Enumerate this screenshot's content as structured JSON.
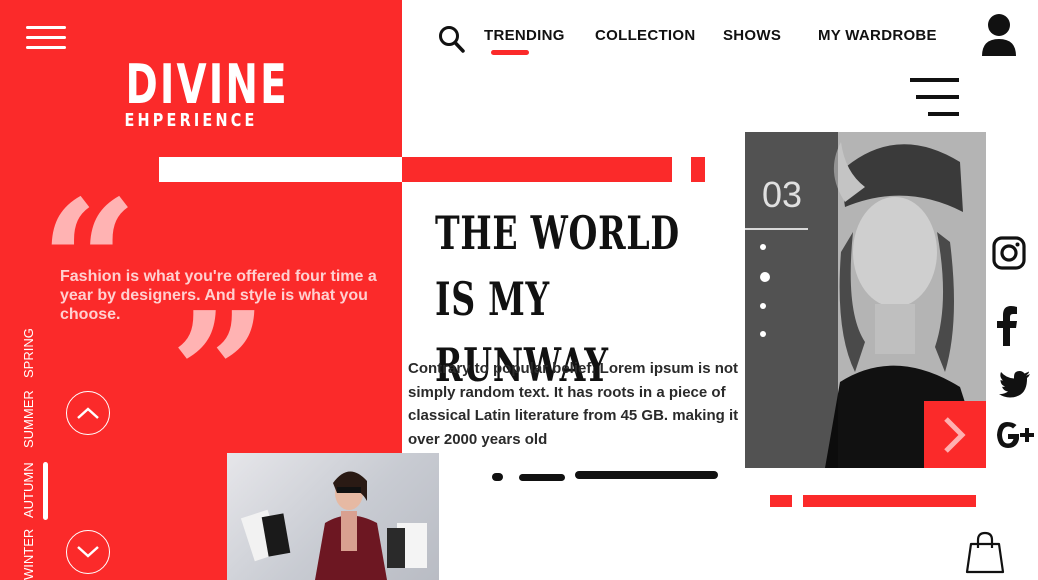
{
  "brand": {
    "title": "DIVINE",
    "subtitle": "EHPERIENCE"
  },
  "nav": {
    "items": [
      "TRENDING",
      "COLLECTION",
      "SHOWS",
      "MY WARDROBE"
    ],
    "active": "TRENDING"
  },
  "quote": {
    "open_mark": "“",
    "close_mark": "”",
    "text": "Fashion is what you're offered four time a year by designers. And style is what you choose."
  },
  "seasons": [
    "SPRING",
    "SUMMER",
    "AUTUMN",
    "WINTER"
  ],
  "seasons_active": "AUTUMN",
  "article": {
    "heading_line1": "THE WORLD IS MY",
    "heading_line2": "RUNWAY",
    "body": "Contrary to  popular belief. Lorem ipsum is not simply random text. It has roots in a piece of classical Latin literature from 45 GB. making  it over 2000 years old"
  },
  "slider": {
    "counter": "03"
  },
  "icons": {
    "menu": "hamburger-icon",
    "search": "search-icon",
    "user": "user-icon",
    "right_menu": "menu-lines-icon",
    "next": "chevron-right-icon",
    "up": "chevron-up-icon",
    "down": "chevron-down-icon",
    "instagram": "instagram-icon",
    "facebook": "facebook-icon",
    "twitter": "twitter-icon",
    "google_plus": "google-plus-icon",
    "bag": "shopping-bag-icon"
  },
  "colors": {
    "accent": "#fb2a2a",
    "text": "#111111",
    "quote": "#ffb3b3"
  }
}
